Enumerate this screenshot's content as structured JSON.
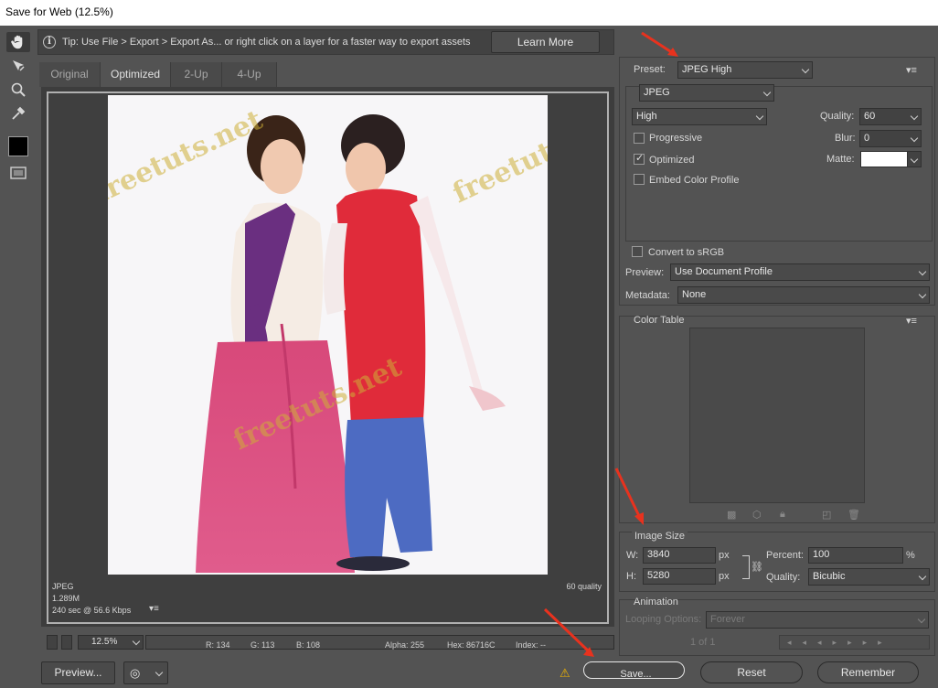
{
  "window": {
    "title": "Save for Web (12.5%)"
  },
  "tip": {
    "text": "Tip: Use File > Export > Export As...  or right click on a layer for a faster way to export assets",
    "learn_more": "Learn More"
  },
  "tabs": [
    "Original",
    "Optimized",
    "2-Up",
    "4-Up"
  ],
  "preview_info": {
    "format": "JPEG",
    "size": "1.289M",
    "speed": "240 sec @ 56.6 Kbps",
    "quality": "60 quality"
  },
  "watermark": "freetuts.net",
  "status": {
    "zoom": "12.5%",
    "r": "R: 134",
    "g": "G: 113",
    "b": "B: 108",
    "alpha": "Alpha: 255",
    "hex": "Hex: 86716C",
    "index": "Index: --"
  },
  "bottom": {
    "preview": "Preview...",
    "save": "Save...",
    "reset": "Reset",
    "remember": "Remember"
  },
  "settings": {
    "preset_label": "Preset:",
    "preset": "JPEG High",
    "format": "JPEG",
    "compression": "High",
    "quality_label": "Quality:",
    "quality": "60",
    "progressive": "Progressive",
    "blur_label": "Blur:",
    "blur": "0",
    "optimized": "Optimized",
    "matte_label": "Matte:",
    "embed": "Embed Color Profile",
    "convert": "Convert to sRGB",
    "preview_label": "Preview:",
    "preview": "Use Document Profile",
    "metadata_label": "Metadata:",
    "metadata": "None"
  },
  "color_table": {
    "title": "Color Table"
  },
  "image_size": {
    "title": "Image Size",
    "w_label": "W:",
    "w": "3840",
    "h_label": "H:",
    "h": "5280",
    "unit": "px",
    "percent_label": "Percent:",
    "percent": "100",
    "percent_unit": "%",
    "quality_label": "Quality:",
    "quality": "Bicubic"
  },
  "animation": {
    "title": "Animation",
    "looping_label": "Looping Options:",
    "looping": "Forever",
    "frame": "1 of 1"
  },
  "colors": {
    "panel": "#535353",
    "dark": "#424242",
    "arrow": "#e8321e"
  }
}
